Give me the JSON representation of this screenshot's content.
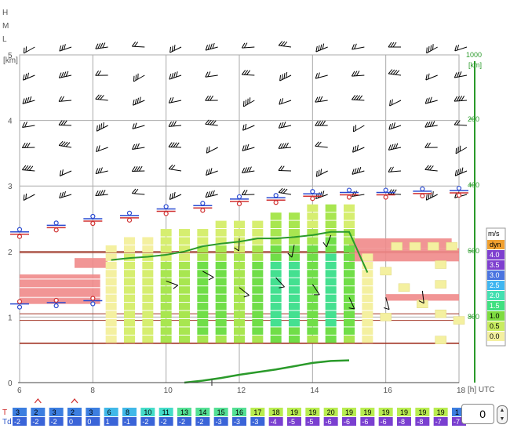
{
  "level_labels": [
    "H",
    "M",
    "L"
  ],
  "km_unit": "[km]",
  "pressure_unit": "[km]",
  "pressure_top": "1000",
  "x_unit": "[h] UTC",
  "legend": {
    "title": "m/s",
    "entries": [
      {
        "label": "dyn",
        "color": "#f0a030"
      },
      {
        "label": "4.0",
        "color": "#7e3fcf"
      },
      {
        "label": "3.5",
        "color": "#7e3fcf"
      },
      {
        "label": "3.0",
        "color": "#4a74e0"
      },
      {
        "label": "2.5",
        "color": "#3fb6f0"
      },
      {
        "label": "2.0",
        "color": "#44e0b0"
      },
      {
        "label": "1.5",
        "color": "#40e080"
      },
      {
        "label": "1.0",
        "color": "#7edc40"
      },
      {
        "label": "0.5",
        "color": "#c8ec60"
      },
      {
        "label": "0.0",
        "color": "#f4f0a0"
      }
    ]
  },
  "row_labels": {
    "t": "T",
    "td": "Td"
  },
  "stepper_value": "0",
  "chart_data": {
    "type": "heatmap",
    "x_range": [
      6,
      18
    ],
    "x_ticks": [
      6,
      8,
      10,
      12,
      14,
      16,
      18
    ],
    "y_range": [
      0,
      5
    ],
    "y_ticks": [
      0,
      1,
      2,
      3,
      4,
      5
    ],
    "pressure_ticks": [
      "1000",
      "800",
      "600",
      "400",
      "200"
    ],
    "temperature_row": {
      "hours": [
        6,
        6.5,
        7,
        7.5,
        8,
        8.5,
        9,
        9.5,
        10,
        10.5,
        11,
        11.5,
        12,
        12.5,
        13,
        13.5,
        14,
        14.5,
        15,
        15.5,
        16,
        16.5,
        17,
        17.5,
        18
      ],
      "T": [
        "3",
        "2",
        "3",
        "2",
        "3",
        "6",
        "8",
        "10",
        "11",
        "13",
        "14",
        "15",
        "16",
        "17",
        "18",
        "19",
        "19",
        "20",
        "19",
        "19",
        "19",
        "19",
        "19",
        "19",
        "1"
      ],
      "Td": [
        "-2",
        "-2",
        "-2",
        "0",
        "0",
        "1",
        "-1",
        "-2",
        "-2",
        "-2",
        "-2",
        "-3",
        "-3",
        "-3",
        "-4",
        "-5",
        "-5",
        "-6",
        "-6",
        "-6",
        "-6",
        "-8",
        "-8",
        "-7",
        "-7"
      ]
    },
    "updraft_columns": [
      {
        "hour": 8.5,
        "top": 2.1,
        "strength": 0.5
      },
      {
        "hour": 9,
        "top": 2.2,
        "strength": 1.0
      },
      {
        "hour": 9.5,
        "top": 2.2,
        "strength": 1.0
      },
      {
        "hour": 10,
        "top": 2.3,
        "strength": 1.5
      },
      {
        "hour": 10.5,
        "top": 2.4,
        "strength": 1.5
      },
      {
        "hour": 11,
        "top": 2.4,
        "strength": 2.0
      },
      {
        "hour": 11.5,
        "top": 2.5,
        "strength": 2.0
      },
      {
        "hour": 12,
        "top": 2.5,
        "strength": 1.5
      },
      {
        "hour": 12.5,
        "top": 2.5,
        "strength": 2.0
      },
      {
        "hour": 13,
        "top": 2.6,
        "strength": 2.5
      },
      {
        "hour": 13.5,
        "top": 2.6,
        "strength": 2.5
      },
      {
        "hour": 14,
        "top": 2.7,
        "strength": 2.0
      },
      {
        "hour": 14.5,
        "top": 2.7,
        "strength": 2.5
      },
      {
        "hour": 15,
        "top": 2.7,
        "strength": 2.0
      },
      {
        "hour": 15.5,
        "top": 2.0,
        "strength": 0.0
      }
    ],
    "boundary_layer_line": {
      "x": [
        8.5,
        9,
        9.5,
        10,
        10.5,
        11,
        11.5,
        12,
        12.5,
        13,
        13.5,
        14,
        14.5,
        15,
        15.5
      ],
      "y": [
        1.87,
        1.9,
        1.92,
        1.95,
        2.0,
        2.08,
        2.12,
        2.15,
        2.2,
        2.2,
        2.22,
        2.25,
        2.3,
        2.3,
        1.68
      ]
    },
    "cloud_bands": [
      {
        "x0": 6,
        "x1": 8.2,
        "y0": 1.2,
        "y1": 1.65
      },
      {
        "x0": 7.5,
        "x1": 8.4,
        "y0": 1.75,
        "y1": 1.9
      },
      {
        "x0": 15,
        "x1": 17.8,
        "y0": 2.05,
        "y1": 2.2
      },
      {
        "x0": 15,
        "x1": 18,
        "y0": 1.85,
        "y1": 2.05
      },
      {
        "x0": 16,
        "x1": 18,
        "y0": 1.25,
        "y1": 1.35
      }
    ],
    "wind_level_rows_km": [
      5.0,
      4.5,
      4.0,
      3.5,
      3.0
    ],
    "bottom_curve": {
      "x": [
        10.5,
        11,
        11.5,
        12,
        12.5,
        13,
        13.5,
        14,
        14.5,
        15
      ],
      "y": [
        0.0,
        0.03,
        0.07,
        0.12,
        0.16,
        0.2,
        0.25,
        0.3,
        0.33,
        0.34
      ]
    }
  }
}
